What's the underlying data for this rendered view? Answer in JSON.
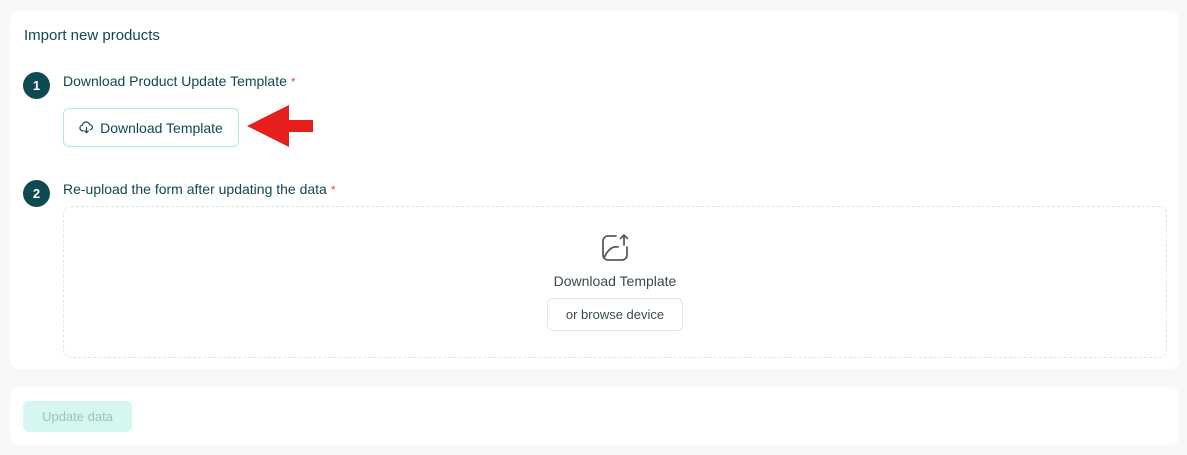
{
  "import_card": {
    "title": "Import new products",
    "step1": {
      "number": "1",
      "label": "Download Product Update Template",
      "required_mark": "*",
      "button_label": "Download Template",
      "button_icon": "cloud-download-icon"
    },
    "step2": {
      "number": "2",
      "label": "Re-upload the form after updating the data",
      "required_mark": "*",
      "dropzone": {
        "icon": "image-upload-icon",
        "title": "Download Template",
        "browse_label": "or browse device"
      }
    }
  },
  "footer": {
    "update_label": "Update data"
  },
  "colors": {
    "primary": "#0e4a52",
    "required": "#e04a3a",
    "button_border": "#a8ebe3",
    "disabled_bg": "#d5f7f2",
    "annotation_arrow": "#e51e1e"
  }
}
